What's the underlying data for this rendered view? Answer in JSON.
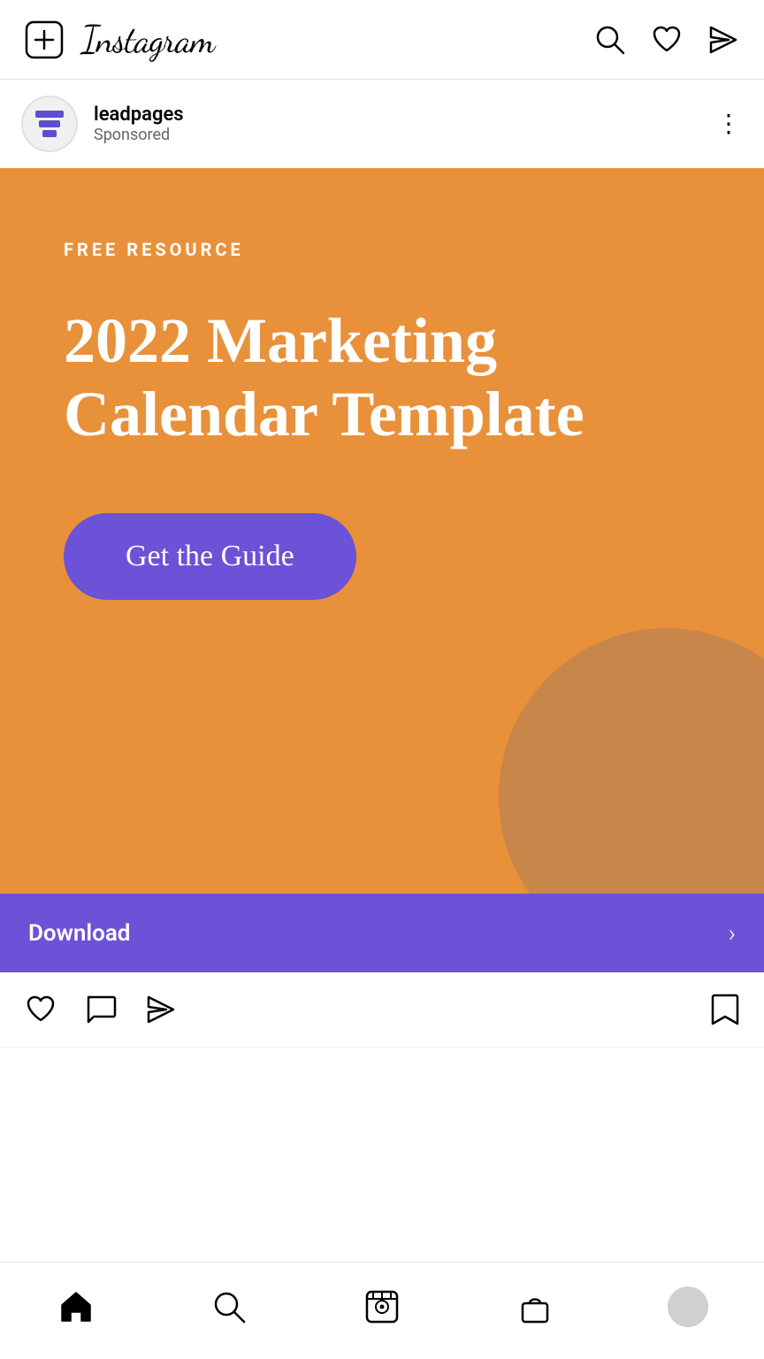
{
  "app": {
    "name": "Instagram"
  },
  "nav": {
    "logo": "Instagram",
    "icons": {
      "new_post": "new-post",
      "search": "search",
      "activity": "heart",
      "messages": "send"
    }
  },
  "post": {
    "username": "leadpages",
    "sponsored_label": "Sponsored",
    "more_options_label": "⋮"
  },
  "ad": {
    "tag": "FREE RESOURCE",
    "title": "2022 Marketing Calendar Template",
    "cta_button": "Get the Guide"
  },
  "download_bar": {
    "label": "Download",
    "chevron": "›"
  },
  "bottom_nav": {
    "items": [
      {
        "name": "home",
        "label": "Home"
      },
      {
        "name": "search",
        "label": "Search"
      },
      {
        "name": "reels",
        "label": "Reels"
      },
      {
        "name": "shop",
        "label": "Shop"
      },
      {
        "name": "profile",
        "label": "Profile"
      }
    ]
  },
  "colors": {
    "orange_bg": "#E8913A",
    "purple_btn": "#6B52D6",
    "circle_tan": "#C9864A"
  }
}
